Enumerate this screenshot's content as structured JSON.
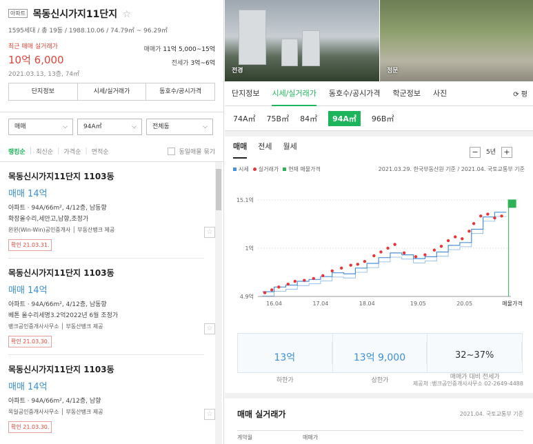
{
  "complex": {
    "type_badge": "아파트",
    "name": "목동신시가지11단지",
    "summary": "1595세대 / 총 19동 / 1988.10.06 / 74.79㎡ ~ 96.29㎡",
    "recent_label": "최근 매매 실거래가",
    "recent_price": "10억 6,000",
    "recent_detail": "2021.03.13, 13층, 74㎡",
    "sale_label": "매매가",
    "sale_range": "11억 5,000~15억",
    "jeonse_label": "전세가",
    "jeonse_range": "3억~6억",
    "tabs": [
      "단지정보",
      "시세/실거래가",
      "동호수/공시가격"
    ]
  },
  "filters": {
    "deal": "매매",
    "area": "94A㎡",
    "dong": "전체동"
  },
  "sort": {
    "options": [
      "랭킹순",
      "최신순",
      "가격순",
      "면적순"
    ],
    "group_label": "동일매물 묶기"
  },
  "listings": [
    {
      "name": "목동신시가지11단지 1103동",
      "price": "매매 14억",
      "info": "아파트 · 94A/66m², 4/12층, 남동향",
      "desc": "확장올수리,세안고,남향,조정가",
      "agent": "윈윈(Win-Win)공인중개사 │ 부동산뱅크 제공",
      "confirm": "확인 21.03.31."
    },
    {
      "name": "목동신시가지11단지 1103동",
      "price": "매매 14억",
      "info": "아파트 · 94A/66m², 4/12층, 남동향",
      "desc": "베톤 올수리세명3.2억2022년 6월 조정가",
      "agent": "뱅크공인중개사사무소 │ 부동산뱅크 제공",
      "confirm": "확인 21.03.30."
    },
    {
      "name": "목동신시가지11단지 1103동",
      "price": "매매 14억",
      "info": "아파트 · 94A/66m², 4/12층, 남향",
      "desc": "",
      "agent": "목일공인중개사사무소 │ 부동산뱅크 제공",
      "confirm": "확인 21.03.30."
    }
  ],
  "photos": {
    "left_label": "전경",
    "right_label": "정문"
  },
  "nav_tabs": [
    "단지정보",
    "시세/실거래가",
    "동호수/공시가격",
    "학군정보",
    "사진"
  ],
  "refresh_label": "평",
  "area_tabs": [
    "74A㎡",
    "75B㎡",
    "84㎡",
    "94A㎡",
    "96B㎡"
  ],
  "deal_tabs": [
    "매매",
    "전세",
    "월세"
  ],
  "zoom": {
    "minus": "−",
    "period": "5년",
    "plus": "+"
  },
  "legend": {
    "items": [
      "시세",
      "실거래가",
      "현재 매물가격"
    ],
    "basis": "2021.03.29. 한국부동산원 기준 / 2021.04. 국토교통부 기준"
  },
  "colors": {
    "market": "#4a90d9",
    "actual": "#e8333a",
    "current": "#2db255",
    "accent": "#1db55b"
  },
  "chart_data": {
    "type": "line",
    "y_ticks": [
      "15.1억",
      "1억",
      "4.9억"
    ],
    "x_ticks": [
      "16.04",
      "17.04",
      "18.04",
      "19.05",
      "20.05",
      "매물가격"
    ],
    "ylim": [
      4.9,
      15.1
    ],
    "series": [
      {
        "name": "시세",
        "x": [
          2016.0,
          2016.25,
          2016.5,
          2016.75,
          2017.0,
          2017.25,
          2017.5,
          2017.75,
          2018.0,
          2018.25,
          2018.5,
          2018.75,
          2019.0,
          2019.25,
          2019.5,
          2019.75,
          2020.0,
          2020.25,
          2020.5,
          2020.75,
          2021.0,
          2021.25
        ],
        "values": [
          5.4,
          5.9,
          6.1,
          6.5,
          6.7,
          7.0,
          7.4,
          7.3,
          7.9,
          8.4,
          9.0,
          9.5,
          9.3,
          8.9,
          9.1,
          9.6,
          10.3,
          10.6,
          12.0,
          13.3,
          13.8,
          13.8
        ]
      },
      {
        "name": "실거래가",
        "x": [
          2016.05,
          2016.2,
          2016.35,
          2016.55,
          2016.7,
          2016.9,
          2017.1,
          2017.3,
          2017.5,
          2017.7,
          2017.9,
          2018.05,
          2018.2,
          2018.4,
          2018.55,
          2018.7,
          2018.85,
          2019.05,
          2019.3,
          2019.5,
          2019.7,
          2019.85,
          2020.0,
          2020.15,
          2020.3,
          2020.45,
          2020.55,
          2020.7,
          2020.85,
          2021.0,
          2021.15
        ],
        "values": [
          5.3,
          5.6,
          5.9,
          6.2,
          6.5,
          6.6,
          6.8,
          7.1,
          7.6,
          7.9,
          8.2,
          8.3,
          8.6,
          9.2,
          9.6,
          10.0,
          10.4,
          9.5,
          9.1,
          9.3,
          9.8,
          10.2,
          10.8,
          11.2,
          11.0,
          11.8,
          12.6,
          13.4,
          13.6,
          13.2,
          13.4
        ]
      },
      {
        "name": "현재 매물가격",
        "x": [
          2021.3
        ],
        "values": [
          15.0
        ]
      }
    ]
  },
  "stats": [
    {
      "value": "13억",
      "label": "하한가"
    },
    {
      "value": "13억 9,000",
      "label": "상한가"
    },
    {
      "value": "32~37%",
      "label": "매매가 대비 전세가"
    }
  ],
  "provider": "제공처 :뱅크공인중개사사무소 02-2649-4488",
  "trades": {
    "title": "매매 실거래가",
    "basis": "2021.04. 국토교통부 기준",
    "headers": [
      "계약월",
      "매매가"
    ]
  }
}
